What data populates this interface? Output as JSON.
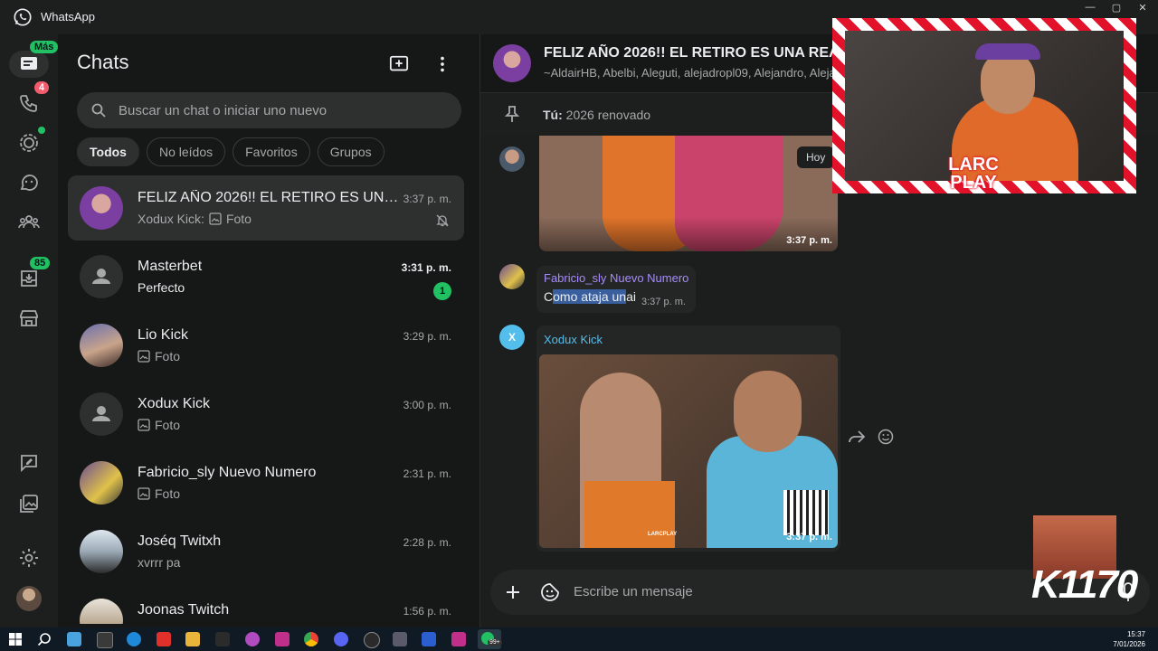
{
  "window": {
    "title": "WhatsApp",
    "controls": [
      "—",
      "▢",
      "✕"
    ]
  },
  "rail": {
    "more_badge": "Más",
    "calls_badge": "4",
    "archived_badge": "85"
  },
  "sidebar": {
    "title": "Chats",
    "search_placeholder": "Buscar un chat o iniciar uno nuevo",
    "filters": [
      "Todos",
      "No leídos",
      "Favoritos",
      "Grupos"
    ],
    "chats": [
      {
        "name": "FELIZ AÑO 2026!! EL RETIRO ES UNA ...",
        "time": "3:37 p. m.",
        "preview_sender": "Xodux Kick:",
        "preview": "Foto"
      },
      {
        "name": "Masterbet",
        "time": "3:31 p. m.",
        "preview": "Perfecto",
        "unread": "1"
      },
      {
        "name": "Lio Kick",
        "time": "3:29 p. m.",
        "preview": "Foto"
      },
      {
        "name": "Xodux Kick",
        "time": "3:00 p. m.",
        "preview": "Foto"
      },
      {
        "name": "Fabricio_sly Nuevo Numero",
        "time": "2:31 p. m.",
        "preview": "Foto"
      },
      {
        "name": "Joséq Twitxh",
        "time": "2:28 p. m.",
        "preview": "xvrrr pa"
      },
      {
        "name": "Joonas Twitch",
        "time": "1:56 p. m.",
        "preview": ""
      }
    ]
  },
  "conversation": {
    "group_name": "FELIZ AÑO 2026!! EL RETIRO ES UNA REALIL",
    "members": "~AldairHB, Abelbi, Aleguti, alejadropl09, Alejandro, Alejan",
    "pinned_sender": "Tú:",
    "pinned_text": "2026 renovado",
    "day_chip": "Hoy",
    "messages": [
      {
        "time": "3:37 p. m."
      },
      {
        "sender": "Fabricio_sly Nuevo Numero",
        "text_highlight": "omo ataja un",
        "text_pre": "C",
        "text_post": "ai",
        "time": "3:37 p. m."
      },
      {
        "sender": "Xodux Kick",
        "avatar_letter": "X",
        "time": "3:37 p. m.",
        "overlay_label": "LARCPLAY"
      }
    ],
    "compose_placeholder": "Escribe un mensaje"
  },
  "overlay": {
    "webcam_logo_line1": "LARC",
    "webcam_logo_line2": "PLAY",
    "counter": "1170",
    "counter_prefix": "K"
  },
  "taskbar": {
    "time": "15:37",
    "date": "7/01/2026",
    "whatsapp_badge": "99+"
  },
  "colors": {
    "accent": "#21c063",
    "danger": "#f15c6d",
    "xodux": "#53bdeb",
    "fabricio": "#a78bfa"
  }
}
